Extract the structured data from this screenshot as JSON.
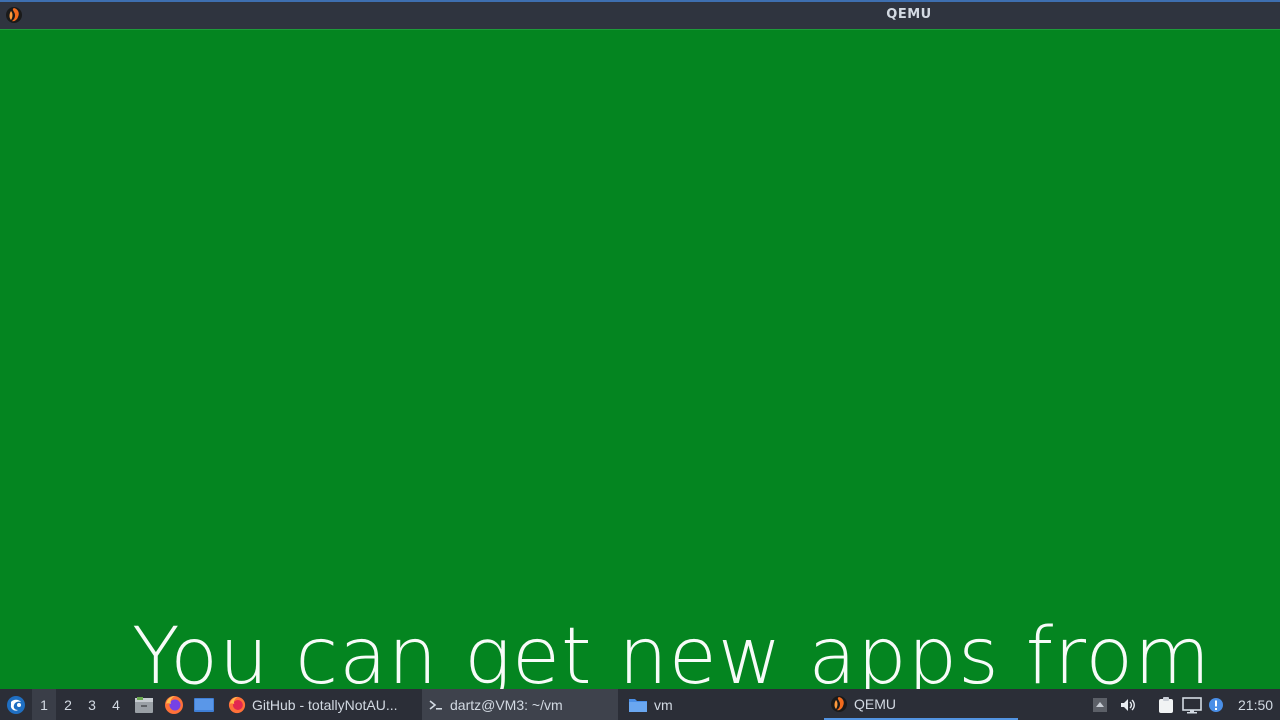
{
  "window": {
    "title": "QEMU",
    "icon": "qemu-icon"
  },
  "guest_screen": {
    "message": "You can get new apps from",
    "background_color": "#048520"
  },
  "taskbar": {
    "start_icon": "lxqt-start-icon",
    "workspaces": [
      {
        "label": "1",
        "active": true
      },
      {
        "label": "2",
        "active": false
      },
      {
        "label": "3",
        "active": false
      },
      {
        "label": "4",
        "active": false
      }
    ],
    "launchers": [
      {
        "icon": "file-manager-icon"
      },
      {
        "icon": "firefox-icon"
      },
      {
        "icon": "show-desktop-icon"
      }
    ],
    "tasks": [
      {
        "label": "GitHub - totallyNotAU...",
        "icon": "firefox-icon"
      },
      {
        "label": "dartz@VM3: ~/vm",
        "icon": "terminal-icon"
      },
      {
        "label": "vm",
        "icon": "folder-icon"
      },
      {
        "label": "QEMU",
        "icon": "qemu-icon"
      }
    ],
    "tray_icons": [
      "tray-expand-icon",
      "volume-icon",
      "clipboard-icon",
      "network-icon",
      "update-notifier-icon"
    ],
    "clock": "21:50"
  }
}
